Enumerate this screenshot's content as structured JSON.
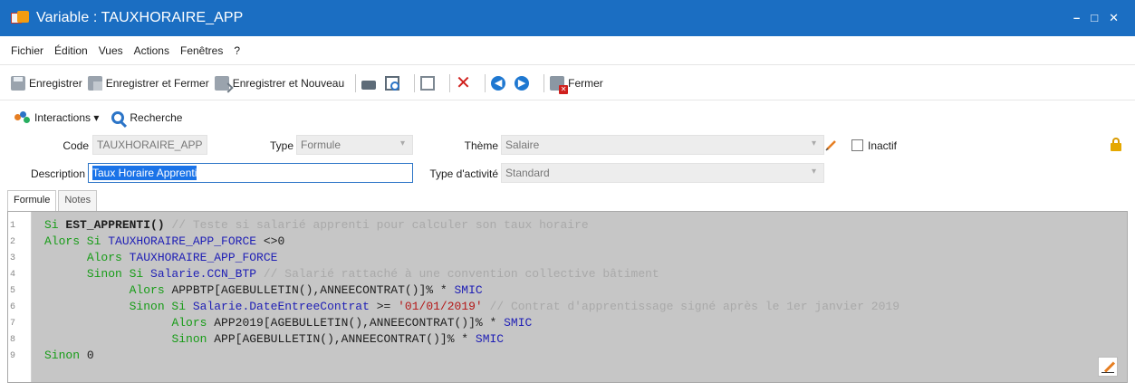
{
  "window": {
    "title": "Variable : TAUXHORAIRE_APP",
    "minimize": "–",
    "maximize": "□",
    "close": "✕"
  },
  "menu": [
    "Fichier",
    "Édition",
    "Vues",
    "Actions",
    "Fenêtres",
    "?"
  ],
  "toolbar": {
    "save": "Enregistrer",
    "save_close": "Enregistrer et Fermer",
    "save_new": "Enregistrer et Nouveau",
    "prev": "◀",
    "next": "▶",
    "close": "Fermer"
  },
  "toolbar2": {
    "interactions": "Interactions ▾",
    "search": "Recherche"
  },
  "form": {
    "code_label": "Code",
    "code_value": "TAUXHORAIRE_APP",
    "type_label": "Type",
    "type_value": "Formule",
    "theme_label": "Thème",
    "theme_value": "Salaire",
    "inactive_label": "Inactif",
    "description_label": "Description",
    "description_value": "Taux Horaire Apprenti",
    "activity_label": "Type d'activité",
    "activity_value": "Standard"
  },
  "tabs": [
    "Formule",
    "Notes"
  ],
  "code_editor": {
    "line_numbers": [
      "1",
      "2",
      "3",
      "4",
      "5",
      "6",
      "7",
      "8",
      "9"
    ],
    "lines": [
      {
        "indent": "",
        "parts": [
          {
            "t": "Si ",
            "c": "kw"
          },
          {
            "t": "EST_APPRENTI()",
            "c": "pl bold"
          },
          {
            "t": " // Teste si salarié apprenti pour calculer son taux horaire",
            "c": "cm"
          }
        ]
      },
      {
        "indent": "",
        "parts": [
          {
            "t": "Alors Si ",
            "c": "kw"
          },
          {
            "t": "TAUXHORAIRE_APP_FORCE",
            "c": "fn"
          },
          {
            "t": " <>0",
            "c": "pl"
          }
        ]
      },
      {
        "indent": "      ",
        "parts": [
          {
            "t": "Alors ",
            "c": "kw"
          },
          {
            "t": "TAUXHORAIRE_APP_FORCE",
            "c": "fn"
          }
        ]
      },
      {
        "indent": "      ",
        "parts": [
          {
            "t": "Sinon Si ",
            "c": "kw"
          },
          {
            "t": "Salarie.CCN_BTP",
            "c": "fn"
          },
          {
            "t": " // Salarié rattaché à une convention collective bâtiment",
            "c": "cm"
          }
        ]
      },
      {
        "indent": "            ",
        "parts": [
          {
            "t": "Alors ",
            "c": "kw"
          },
          {
            "t": "APPBTP[AGEBULLETIN(),ANNEECONTRAT()]% * ",
            "c": "pl"
          },
          {
            "t": "SMIC",
            "c": "fn"
          }
        ]
      },
      {
        "indent": "            ",
        "parts": [
          {
            "t": "Sinon Si ",
            "c": "kw"
          },
          {
            "t": "Salarie.DateEntreeContrat",
            "c": "fn"
          },
          {
            "t": " >= ",
            "c": "pl"
          },
          {
            "t": "'01/01/2019'",
            "c": "str"
          },
          {
            "t": " // Contrat d'apprentissage signé après le 1er janvier 2019",
            "c": "cm"
          }
        ]
      },
      {
        "indent": "                  ",
        "parts": [
          {
            "t": "Alors ",
            "c": "kw"
          },
          {
            "t": "APP2019[AGEBULLETIN(),ANNEECONTRAT()]% * ",
            "c": "pl"
          },
          {
            "t": "SMIC",
            "c": "fn"
          }
        ]
      },
      {
        "indent": "                  ",
        "parts": [
          {
            "t": "Sinon ",
            "c": "kw"
          },
          {
            "t": "APP[AGEBULLETIN(),ANNEECONTRAT()]% * ",
            "c": "pl"
          },
          {
            "t": "SMIC",
            "c": "fn"
          }
        ]
      },
      {
        "indent": "",
        "parts": [
          {
            "t": "Sinon ",
            "c": "kw"
          },
          {
            "t": "0",
            "c": "pl"
          }
        ]
      }
    ]
  },
  "colors": {
    "titlebar": "#1b6ec2",
    "keyword": "#179c17",
    "identifier": "#1f1fb5",
    "comment": "#a9a9a9",
    "string": "#b41818"
  }
}
